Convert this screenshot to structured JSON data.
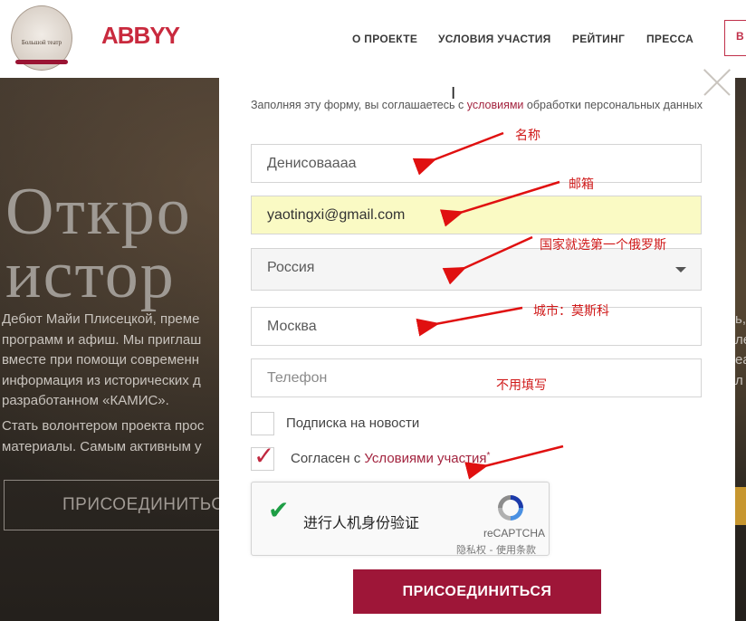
{
  "header": {
    "logo_text": "Большой театр",
    "brand": "ABBYY",
    "nav": [
      "О ПРОЕКТЕ",
      "УСЛОВИЯ УЧАСТИЯ",
      "РЕЙТИНГ",
      "ПРЕССА"
    ],
    "nav_button": "В"
  },
  "hero": {
    "title_line1": "Откро",
    "title_line2": "истор",
    "paragraph1": [
      "Дебют Майи Плисецкой, преме",
      "программ и афиш. Мы приглаш",
      "вместе при помощи современн",
      "информация из исторических д",
      "разработанном «КАМИС»."
    ],
    "paragraph2": [
      "Стать волонтером проекта прос",
      "материалы. Самым активным у"
    ],
    "right_fragments": [
      "ь,",
      "ле",
      "еа",
      "л"
    ],
    "cta": "ПРИСОЕДИНИТЬСЯ"
  },
  "form": {
    "consent_prefix": "Заполняя эту форму, вы соглашаетесь с ",
    "consent_link": "условиями",
    "consent_suffix": " обработки персональных данных",
    "name_value": "Денисоваааа",
    "email_value": "yaotingxi@gmail.com",
    "country_value": "Россия",
    "city_value": "Москва",
    "phone_placeholder": "Телефон",
    "subscribe_label": "Подписка на новости",
    "agree_prefix": "Согласен с ",
    "agree_link": "Условиями участия",
    "agree_required": "*",
    "submit_label": "ПРИСОЕДИНИТЬСЯ"
  },
  "recaptcha": {
    "label": "进行人机身份验证",
    "brand": "reCAPTCHA",
    "terms": "隐私权 - 使用条款"
  },
  "annotations": {
    "name": "名称",
    "email": "邮箱",
    "country": "国家就选第一个俄罗斯",
    "city": "城市：莫斯科",
    "phone": "不用填写"
  }
}
